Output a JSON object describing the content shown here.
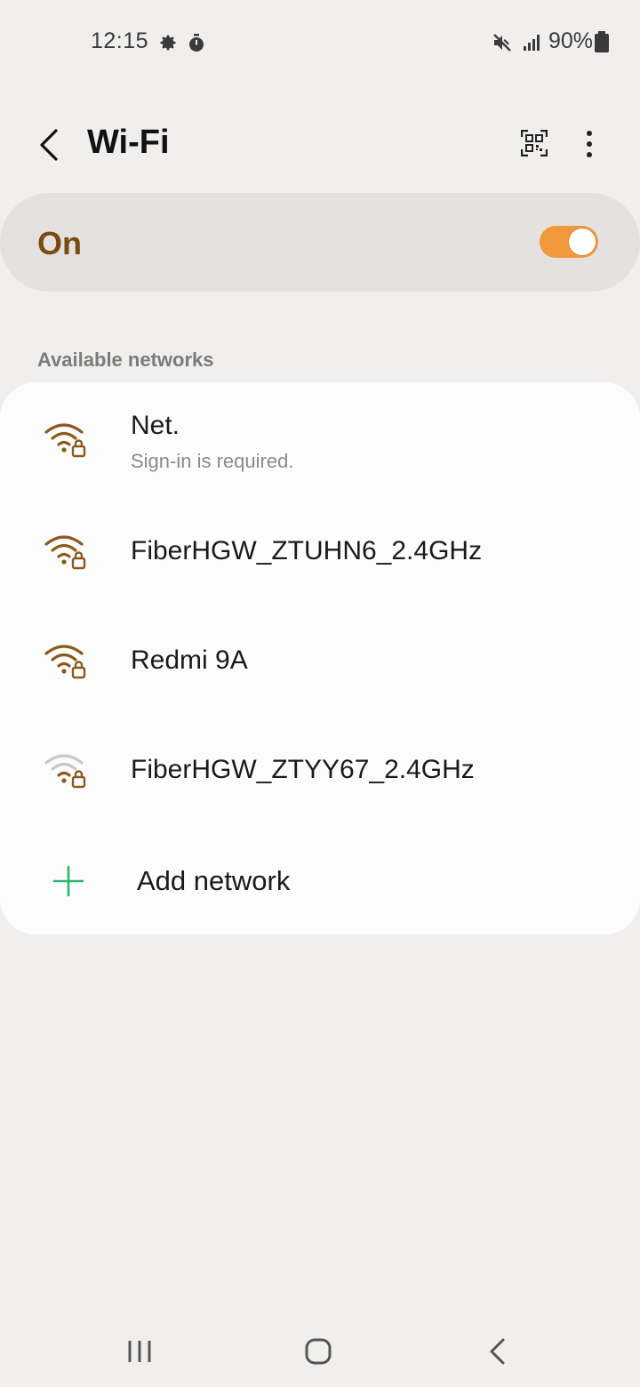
{
  "status_bar": {
    "time": "12:15",
    "battery": "90%",
    "icons": [
      "gear-icon",
      "timer-icon",
      "mute-icon",
      "signal-icon",
      "battery-icon"
    ]
  },
  "header": {
    "title": "Wi-Fi",
    "icons": [
      "back-arrow-icon",
      "qr-code-icon",
      "more-vert-icon"
    ]
  },
  "master_toggle": {
    "label": "On",
    "state": true
  },
  "available_networks": {
    "section_title": "Available networks",
    "networks": [
      {
        "name": "Net.",
        "subtitle": "Sign-in is required.",
        "signal": "full",
        "locked": true
      },
      {
        "name": "FiberHGW_ZTUHN6_2.4GHz",
        "subtitle": "",
        "signal": "full",
        "locked": true
      },
      {
        "name": "Redmi 9A",
        "subtitle": "",
        "signal": "full",
        "locked": true
      },
      {
        "name": "FiberHGW_ZTYY67_2.4GHz",
        "subtitle": "",
        "signal": "weak",
        "locked": true
      }
    ],
    "add_network_label": "Add network"
  },
  "colors": {
    "accent": "#7a4a12",
    "toggle_on": "#f0983a",
    "add_icon": "#2bb673",
    "wifi_active": "#8b5a1a",
    "wifi_inactive": "#c9c9c9"
  },
  "nav_bar": {
    "icons": [
      "recents-icon",
      "home-icon",
      "back-icon"
    ]
  }
}
